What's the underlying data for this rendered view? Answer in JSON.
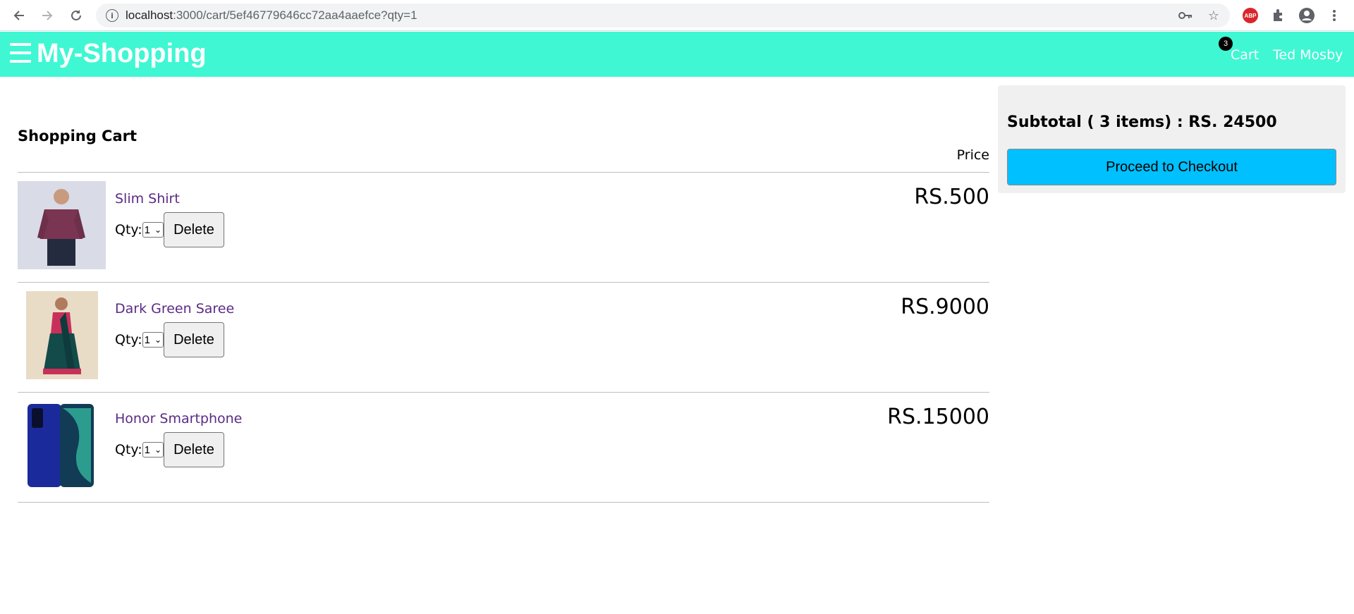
{
  "browser": {
    "url_host": "localhost",
    "url_path": ":3000/cart/5ef46779646cc72aa4aaefce?qty=1"
  },
  "header": {
    "brand": "My-Shopping",
    "cart_label": "Cart",
    "cart_count": "3",
    "user_name": "Ted Mosby",
    "bg_color": "#3ff7d3"
  },
  "cart": {
    "title": "Shopping Cart",
    "price_header": "Price",
    "qty_label": "Qty:",
    "delete_label": "Delete",
    "items": [
      {
        "name": "Slim Shirt",
        "qty": "1",
        "price": "RS.500"
      },
      {
        "name": "Dark Green Saree",
        "qty": "1",
        "price": "RS.9000"
      },
      {
        "name": "Honor Smartphone",
        "qty": "1",
        "price": "RS.15000"
      }
    ]
  },
  "summary": {
    "subtotal": "Subtotal ( 3 items) : RS. 24500",
    "checkout_label": "Proceed to Checkout",
    "checkout_color": "#00c0ff"
  }
}
